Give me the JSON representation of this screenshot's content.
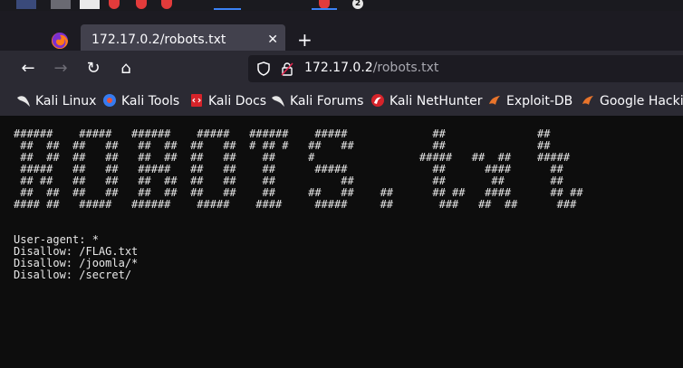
{
  "browser": {
    "taskbar_badge": "2",
    "tab": {
      "title": "172.17.0.2/robots.txt",
      "close": "✕"
    },
    "new_tab": "+",
    "nav": {
      "back": "←",
      "forward": "→",
      "reload": "↻",
      "home": "⌂"
    },
    "url": {
      "host": "172.17.0.2",
      "path": "/robots.txt"
    },
    "bookmarks": [
      {
        "label": "Kali Linux",
        "icon": "kali-dragon-icon"
      },
      {
        "label": "Kali Tools",
        "icon": "kali-tools-icon"
      },
      {
        "label": "Kali Docs",
        "icon": "kali-docs-icon"
      },
      {
        "label": "Kali Forums",
        "icon": "kali-dragon-icon"
      },
      {
        "label": "Kali NetHunter",
        "icon": "nethunter-icon"
      },
      {
        "label": "Exploit-DB",
        "icon": "exploit-db-icon"
      },
      {
        "label": "Google Hacking",
        "icon": "exploit-db-icon"
      }
    ]
  },
  "page": {
    "ascii_banner": [
      "######    #####   ######    #####   ######    #####             ##              ##",
      " ##  ##  ##   ##   ##  ##  ##   ##  # ## #   ##   ##            ##              ##",
      " ##  ##  ##   ##   ##  ##  ##   ##    ##     #                #####   ##  ##    #####",
      " #####   ##   ##   #####   ##   ##    ##      #####             ##      ####      ##",
      " ## ##   ##   ##   ##  ##  ##   ##    ##          ##            ##       ##       ##",
      " ##  ##  ##   ##   ##  ##  ##   ##    ##     ##   ##    ##      ## ##   ####      ## ##",
      "#### ##   #####   ######    #####    ####     #####     ##       ###   ##  ##      ###"
    ],
    "lines": [
      "User-agent: *",
      "Disallow: /FLAG.txt",
      "Disallow: /joomla/*",
      "Disallow: /secret/"
    ]
  },
  "colors": {
    "page_bg": "#0d0d0d",
    "chrome_bg": "#2b2a33",
    "tab_active": "#42414d",
    "accent": "#3b82f6"
  }
}
